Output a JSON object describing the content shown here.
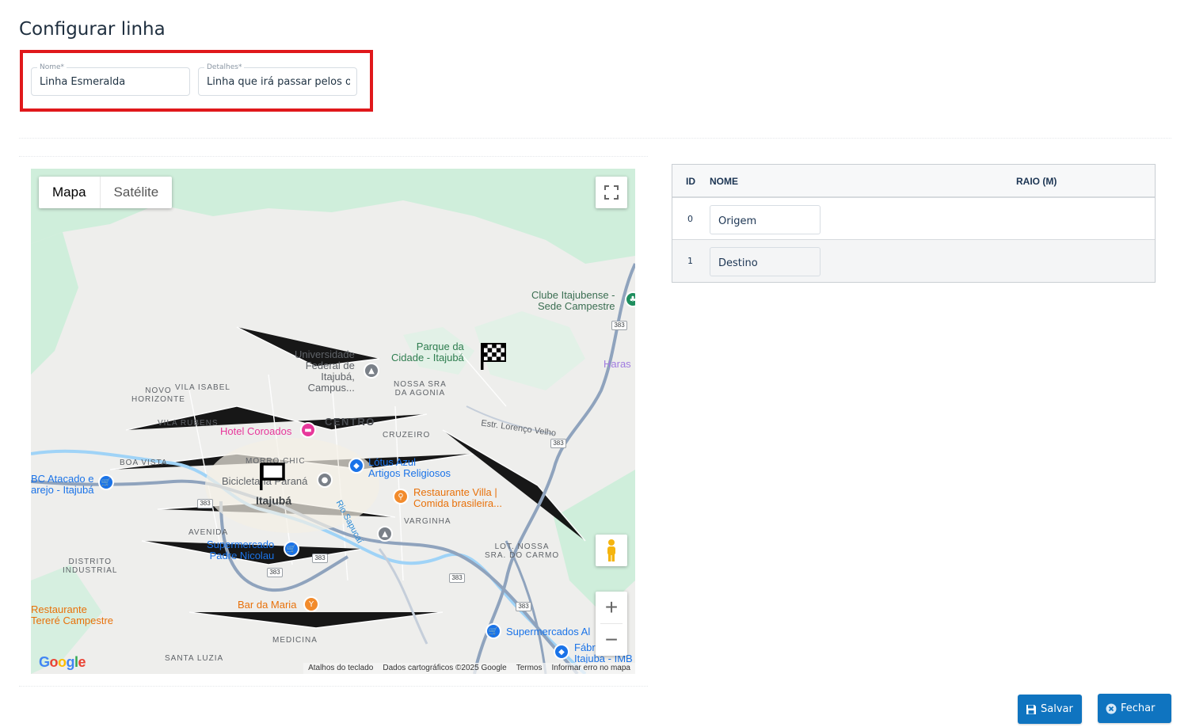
{
  "page": {
    "title": "Configurar linha"
  },
  "form": {
    "nome": {
      "label": "Nome*",
      "value": "Linha Esmeralda"
    },
    "detalhes": {
      "label": "Detalhes*",
      "value": "Linha que irá passar pelos os"
    }
  },
  "map": {
    "type_tabs": [
      "Mapa",
      "Satélite"
    ],
    "active_tab": "Mapa",
    "footer": [
      "Atalhos do teclado",
      "Dados cartográficos ©2025 Google",
      "Termos",
      "Informar erro no mapa"
    ],
    "logo": "Google",
    "labels": {
      "clube": "Clube Itajubense -\nSede Campestre",
      "haras": "Haras",
      "universidade": "Universidade\nFederal de\nItajubá,\nCampus...",
      "parque": "Parque da\nCidade - Itajubá",
      "novo_horizonte": "NOVO\nHORIZONTE",
      "vila_isabel": "VILA ISABEL",
      "nossa_sra_agonia": "NOSSA SRA\nDA AGONIA",
      "vila_rubens": "VILA RUBENS",
      "hotel": "Hotel Coroados",
      "centro": "CENTRO",
      "cruzeiro": "CRUZEIRO",
      "estrada": "Estr. Lorenço Velho",
      "boa_vista": "BOA VISTA",
      "morro_chic": "MORRO CHIC",
      "atacado": "BC Atacado e\narejo - Itajubá",
      "bicicletaria": "Bicicletaria Paraná",
      "lotus": "Lótus Azul\nArtigos Religiosos",
      "itajuba": "Itajubá",
      "restaurante_villa": "Restaurante Villa |\nComida brasileira...",
      "rio": "Rio Sapucaí",
      "varginha": "VARGINHA",
      "avenida": "AVENIDA",
      "supermercado_padre": "Supermercado\nPadre Nicolau",
      "lot_nossa": "LOT. NOSSA\nSRA. DO CARMO",
      "distrito": "DISTRITO\nINDUSTRIAL",
      "restaurante_terere": "Restaurante\nTereré Campestre",
      "bar_maria": "Bar da Maria",
      "medicina": "MEDICINA",
      "supermercado_al": "Supermercados Al",
      "fabrica": "Fábr\nItajubá - IMB",
      "santa_luzia": "SANTA LUZIA",
      "nossa_sra": "NOSSA SRA",
      "shield_383": "383"
    }
  },
  "table": {
    "headers": {
      "id": "ID",
      "nome": "NOME",
      "raio": "RAIO (M)"
    },
    "rows": [
      {
        "id": "0",
        "nome": "Origem"
      },
      {
        "id": "1",
        "nome": "Destino"
      }
    ]
  },
  "buttons": {
    "salvar": "Salvar",
    "fechar": "Fechar"
  },
  "colors": {
    "primary": "#0f74c0",
    "highlight": "#e0181b",
    "heading": "#1c3553"
  }
}
